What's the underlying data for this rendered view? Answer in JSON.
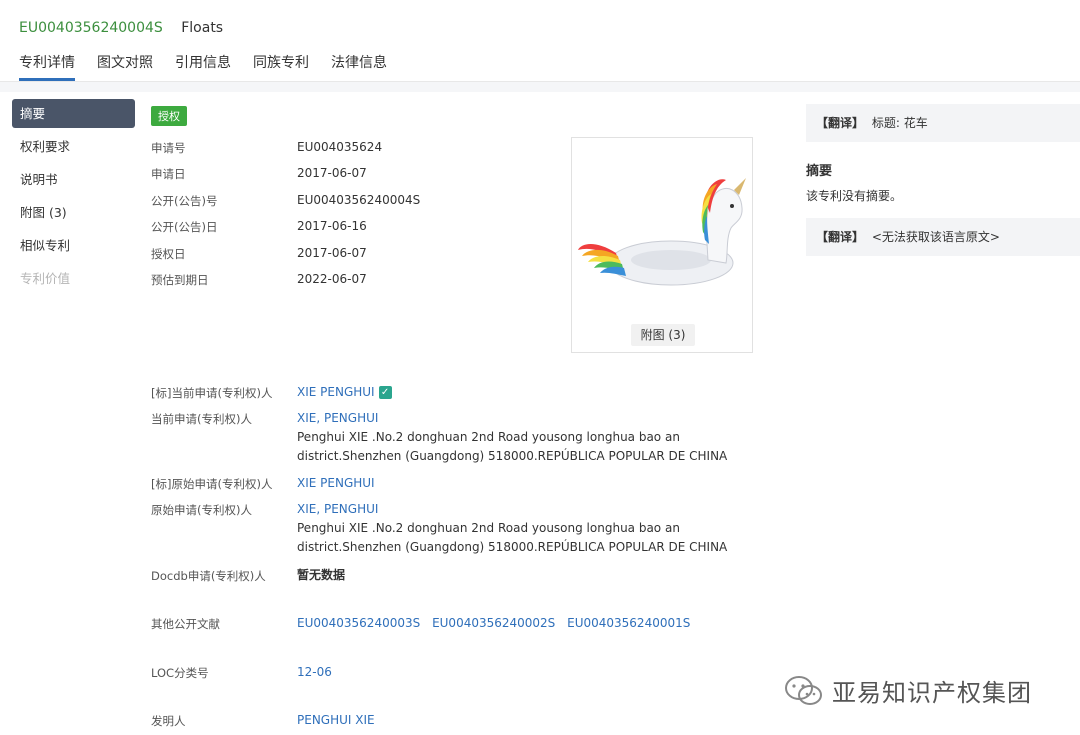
{
  "header": {
    "patent_number": "EU0040356240004S",
    "title": "Floats",
    "tabs": [
      {
        "label": "专利详情",
        "active": true
      },
      {
        "label": "图文对照"
      },
      {
        "label": "引用信息"
      },
      {
        "label": "同族专利"
      },
      {
        "label": "法律信息"
      }
    ]
  },
  "sidebar": {
    "items": [
      {
        "label": "摘要",
        "state": "active"
      },
      {
        "label": "权利要求"
      },
      {
        "label": "说明书"
      },
      {
        "label": "附图 (3)"
      },
      {
        "label": "相似专利"
      },
      {
        "label": "专利价值",
        "state": "disabled"
      }
    ]
  },
  "status_badge": "授权",
  "fields": {
    "application_no": {
      "label": "申请号",
      "value": "EU004035624"
    },
    "application_date": {
      "label": "申请日",
      "value": "2017-06-07"
    },
    "publication_no": {
      "label": "公开(公告)号",
      "value": "EU0040356240004S"
    },
    "publication_date": {
      "label": "公开(公告)日",
      "value": "2017-06-16"
    },
    "grant_date": {
      "label": "授权日",
      "value": "2017-06-07"
    },
    "expiry_date": {
      "label": "预估到期日",
      "value": "2022-06-07"
    },
    "std_current_applicant": {
      "label": "[标]当前申请(专利权)人",
      "value": "XIE PENGHUI"
    },
    "current_applicant": {
      "label": "当前申请(专利权)人",
      "value": "XIE, PENGHUI",
      "address_line1": "Penghui XIE .No.2 donghuan 2nd Road yousong longhua bao an",
      "address_line2": "district.Shenzhen (Guangdong) 518000.REPÚBLICA POPULAR DE CHINA"
    },
    "std_original_applicant": {
      "label": "[标]原始申请(专利权)人",
      "value": "XIE PENGHUI"
    },
    "original_applicant": {
      "label": "原始申请(专利权)人",
      "value": "XIE, PENGHUI",
      "address_line1": "Penghui XIE .No.2 donghuan 2nd Road yousong longhua bao an",
      "address_line2": "district.Shenzhen (Guangdong) 518000.REPÚBLICA POPULAR DE CHINA"
    },
    "docdb_applicant": {
      "label": "Docdb申请(专利权)人",
      "value": "暂无数据"
    },
    "other_publications": {
      "label": "其他公开文献",
      "values": [
        "EU0040356240003S",
        "EU0040356240002S",
        "EU0040356240001S"
      ]
    },
    "loc_class": {
      "label": "LOC分类号",
      "value": "12-06"
    },
    "inventor": {
      "label": "发明人",
      "value": "PENGHUI XIE"
    }
  },
  "figure": {
    "button_label": "附图 (3)"
  },
  "right_panel": {
    "translation1_tag": "【翻译】",
    "translation1_text": "标题: 花车",
    "abstract_title": "摘要",
    "abstract_text": "该专利没有摘要。",
    "translation2_tag": "【翻译】",
    "translation2_text": "<无法获取该语言原文>"
  },
  "watermark": {
    "text": "亚易知识产权集团",
    "icon": "wechat-icon"
  },
  "colors": {
    "accent": "#2f6fba",
    "patent_number": "#3c8f3e",
    "badge": "#3daa3f",
    "sidebar_active": "#4a5568"
  }
}
